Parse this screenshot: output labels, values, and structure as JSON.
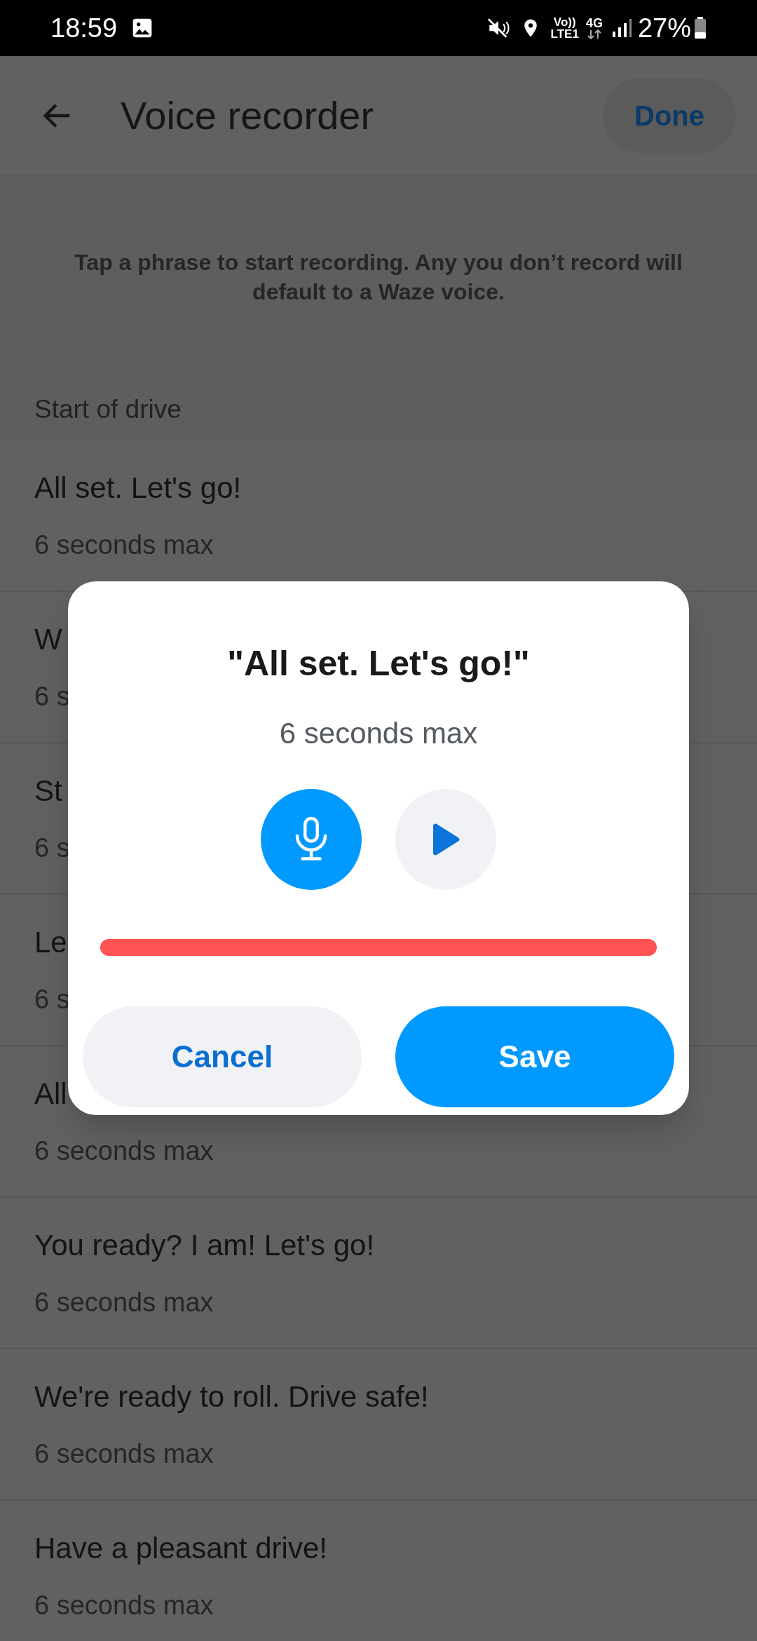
{
  "status_bar": {
    "time": "18:59",
    "volte": "Vo))",
    "lte": "LTE1",
    "network": "4G",
    "battery": "27%"
  },
  "header": {
    "title": "Voice recorder",
    "done": "Done"
  },
  "intro": "Tap a phrase to start recording. Any you don’t record will default to a Waze voice.",
  "section": "Start of drive",
  "phrases": [
    {
      "title": "All set. Let's go!",
      "subtitle": "6 seconds max"
    },
    {
      "title": "W",
      "subtitle": "6 s"
    },
    {
      "title": "St",
      "subtitle": "6 s"
    },
    {
      "title": "Le",
      "subtitle": "6 s"
    },
    {
      "title": "All",
      "subtitle": "6 seconds max"
    },
    {
      "title": "You ready? I am! Let's go!",
      "subtitle": "6 seconds max"
    },
    {
      "title": "We're ready to roll. Drive safe!",
      "subtitle": "6 seconds max"
    },
    {
      "title": "Have a pleasant drive!",
      "subtitle": "6 seconds max"
    }
  ],
  "dialog": {
    "title": "\"All set. Let's go!\"",
    "subtitle": "6 seconds max",
    "cancel": "Cancel",
    "save": "Save"
  }
}
